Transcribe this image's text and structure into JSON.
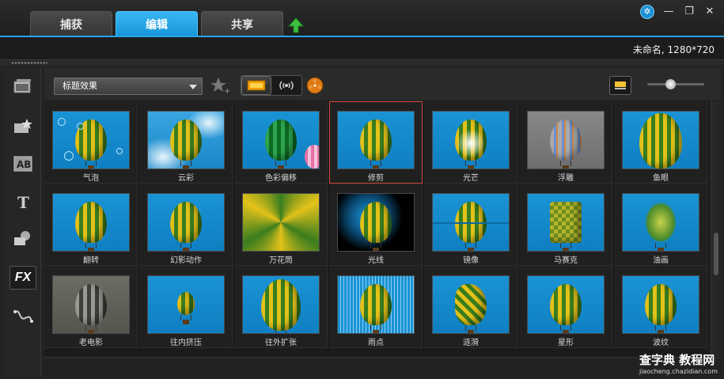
{
  "tabs": [
    {
      "label": "捕获",
      "active": false
    },
    {
      "label": "编辑",
      "active": true
    },
    {
      "label": "共享",
      "active": false
    }
  ],
  "window_controls": {
    "minimize": "—",
    "restore": "❐",
    "close": "✕",
    "settings_icon": "gear-icon"
  },
  "project": {
    "info": "未命名, 1280*720"
  },
  "toolbar": {
    "category_select": "标题效果",
    "slider_level": 0.4
  },
  "sidebar": {
    "items": [
      {
        "name": "media-icon"
      },
      {
        "name": "instant-project-icon"
      },
      {
        "name": "transition-icon"
      },
      {
        "name": "title-icon"
      },
      {
        "name": "graphic-icon"
      },
      {
        "name": "fx-icon",
        "label": "FX",
        "active": true
      },
      {
        "name": "path-icon"
      }
    ]
  },
  "effects": [
    {
      "label": "气泡",
      "variant": "bubbles"
    },
    {
      "label": "云彩",
      "variant": "clouds"
    },
    {
      "label": "色彩偏移",
      "variant": "colorshift"
    },
    {
      "label": "修剪",
      "variant": "plain",
      "selected": true
    },
    {
      "label": "光芒",
      "variant": "glow"
    },
    {
      "label": "浮雕",
      "variant": "emboss"
    },
    {
      "label": "鱼眼",
      "variant": "fisheye"
    },
    {
      "label": "翻转",
      "variant": "plain"
    },
    {
      "label": "幻影动作",
      "variant": "plain"
    },
    {
      "label": "万花筒",
      "variant": "kaleido"
    },
    {
      "label": "光线",
      "variant": "light"
    },
    {
      "label": "镜像",
      "variant": "mirror"
    },
    {
      "label": "马赛克",
      "variant": "mosaic"
    },
    {
      "label": "油画",
      "variant": "oil"
    },
    {
      "label": "老电影",
      "variant": "oldfilm"
    },
    {
      "label": "往内挤压",
      "variant": "small"
    },
    {
      "label": "往外扩张",
      "variant": "big"
    },
    {
      "label": "雨点",
      "variant": "rain"
    },
    {
      "label": "涟漪",
      "variant": "ripple"
    },
    {
      "label": "星形",
      "variant": "plain"
    },
    {
      "label": "波纹",
      "variant": "plain"
    }
  ],
  "watermark": {
    "title": "查字典 教程网",
    "url": "jiaocheng.chazidian.com"
  }
}
